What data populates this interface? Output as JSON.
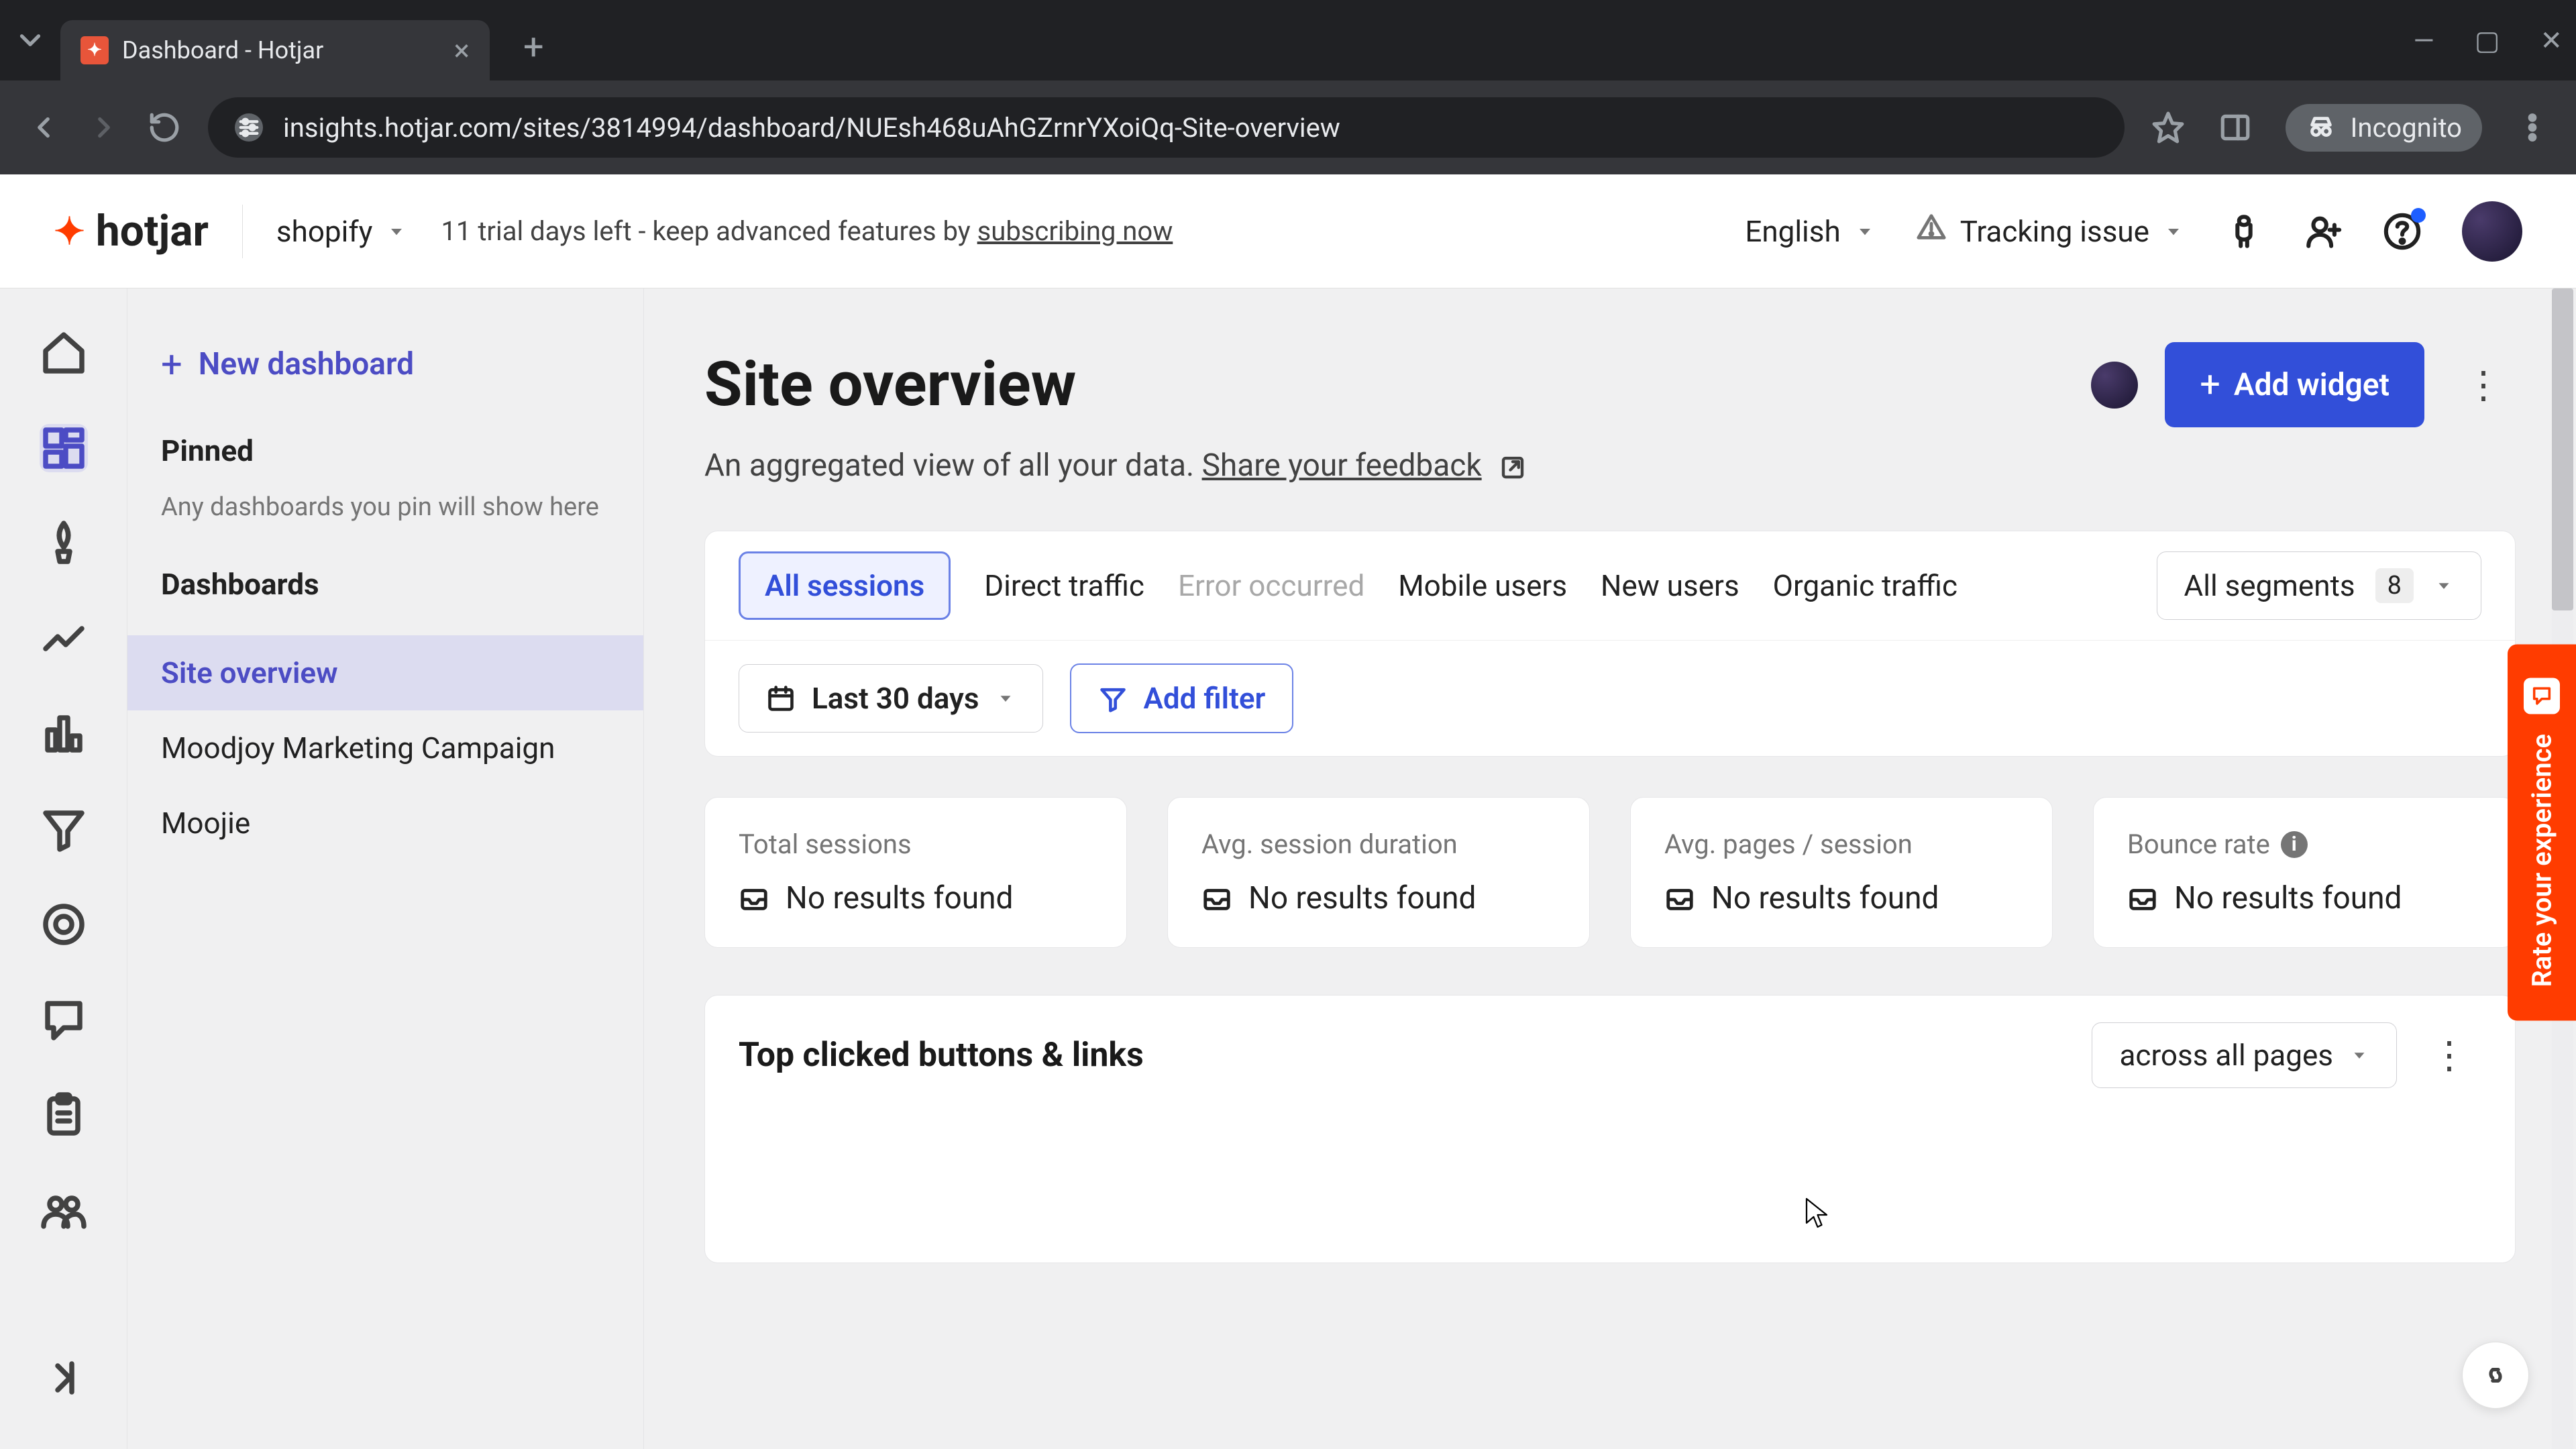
{
  "browser": {
    "tab_title": "Dashboard - Hotjar",
    "url": "insights.hotjar.com/sites/3814994/dashboard/NUEsh468uAhGZrnrYXoiQq-Site-overview",
    "incognito_label": "Incognito"
  },
  "header": {
    "brand": "hotjar",
    "site_picker": "shopify",
    "trial_prefix": "11 trial days left - keep advanced features by ",
    "trial_link": "subscribing now",
    "language": "English",
    "tracking_issue": "Tracking issue"
  },
  "sidebar": {
    "new_dashboard": "New dashboard",
    "pinned_heading": "Pinned",
    "pinned_hint": "Any dashboards you pin will show here",
    "dashboards_heading": "Dashboards",
    "items": [
      {
        "label": "Site overview",
        "active": true
      },
      {
        "label": "Moodjoy Marketing Campaign",
        "active": false
      },
      {
        "label": "Moojie",
        "active": false
      }
    ]
  },
  "page": {
    "title": "Site overview",
    "subtitle_text": "An aggregated view of all your data. ",
    "subtitle_link": "Share your feedback",
    "add_widget": "Add widget"
  },
  "segments": {
    "tabs": [
      {
        "label": "All sessions",
        "state": "active"
      },
      {
        "label": "Direct traffic",
        "state": "normal"
      },
      {
        "label": "Error occurred",
        "state": "disabled"
      },
      {
        "label": "Mobile users",
        "state": "normal"
      },
      {
        "label": "New users",
        "state": "normal"
      },
      {
        "label": "Organic traffic",
        "state": "normal"
      }
    ],
    "all_label": "All segments",
    "all_count": "8"
  },
  "controls": {
    "date_range": "Last 30 days",
    "add_filter": "Add filter"
  },
  "metrics": [
    {
      "label": "Total sessions",
      "value": "No results found",
      "info": false
    },
    {
      "label": "Avg. session duration",
      "value": "No results found",
      "info": false
    },
    {
      "label": "Avg. pages / session",
      "value": "No results found",
      "info": false
    },
    {
      "label": "Bounce rate",
      "value": "No results found",
      "info": true
    }
  ],
  "widget": {
    "title": "Top clicked buttons & links",
    "scope": "across all pages"
  },
  "rate_tab": "Rate your experience"
}
